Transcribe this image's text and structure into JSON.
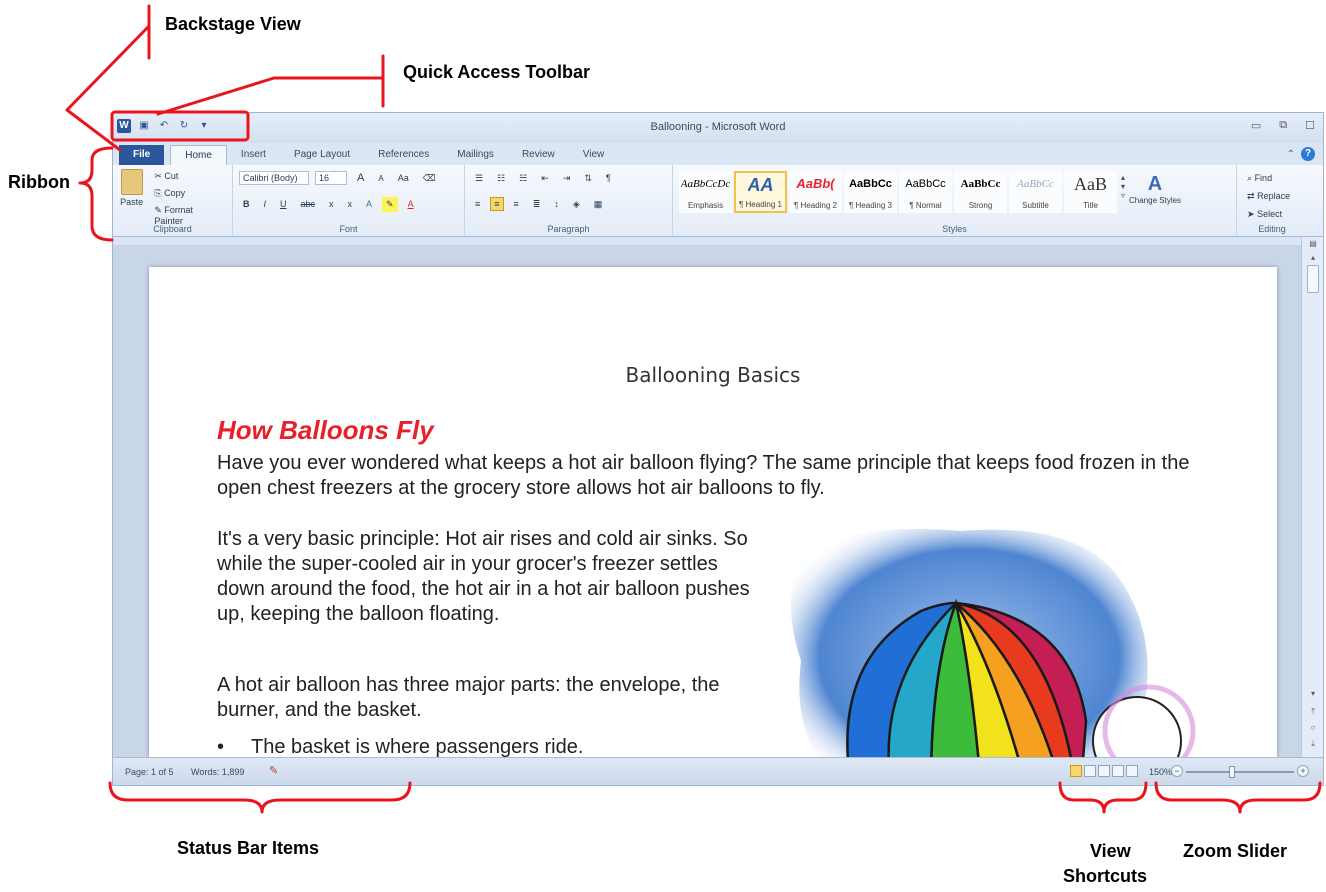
{
  "callouts": {
    "backstage_view": "Backstage View",
    "quick_access_toolbar": "Quick Access Toolbar",
    "ribbon": "Ribbon",
    "status_bar_items": "Status Bar Items",
    "view_shortcuts_line1": "View",
    "view_shortcuts_line2": "Shortcuts",
    "zoom_slider": "Zoom Slider"
  },
  "window": {
    "title": "Ballooning - Microsoft Word"
  },
  "tabs": [
    "File",
    "Home",
    "Insert",
    "Page Layout",
    "References",
    "Mailings",
    "Review",
    "View"
  ],
  "ribbon": {
    "clipboard": {
      "name": "Clipboard",
      "paste": "Paste",
      "cut": "Cut",
      "copy": "Copy",
      "format_painter": "Format Painter"
    },
    "font": {
      "name": "Font",
      "font_name": "Calibri (Body)",
      "font_size": "16",
      "grow": "A",
      "shrink": "A",
      "change_case": "Aa",
      "bold": "B",
      "italic": "I",
      "underline": "U",
      "strike": "abc",
      "subscript": "x",
      "superscript": "x"
    },
    "paragraph": {
      "name": "Paragraph"
    },
    "styles": {
      "name": "Styles",
      "items": [
        {
          "sample": "AaBbCcDc",
          "label": "Emphasis"
        },
        {
          "sample": "AA",
          "label": "¶ Heading 1"
        },
        {
          "sample": "AaBb(",
          "label": "¶ Heading 2"
        },
        {
          "sample": "AaBbCc",
          "label": "¶ Heading 3"
        },
        {
          "sample": "AaBbCc",
          "label": "¶ Normal"
        },
        {
          "sample": "AaBbCc",
          "label": "Strong"
        },
        {
          "sample": "AaBbCc",
          "label": "Subtitle"
        },
        {
          "sample": "AaB",
          "label": "Title"
        }
      ],
      "change_styles": "Change Styles"
    },
    "editing": {
      "name": "Editing",
      "find": "Find",
      "replace": "Replace",
      "select": "Select"
    }
  },
  "document": {
    "title": "Ballooning Basics",
    "heading": "How Balloons Fly",
    "para1": "Have you ever wondered what keeps a hot air balloon flying? The same principle that keeps food frozen in the open chest freezers at the grocery store allows hot air balloons to fly.",
    "para2": "It's a very basic principle: Hot air rises and cold air sinks. So while the super-cooled air in your grocer's freezer settles down around the food, the hot air in a hot air balloon pushes up, keeping the balloon floating.",
    "para3": "A hot air balloon has three major parts: the envelope, the burner, and the basket.",
    "bullet1": "The basket is where passengers ride."
  },
  "status": {
    "page": "Page: 1 of 5",
    "words": "Words: 1,899",
    "zoom": "150%"
  }
}
